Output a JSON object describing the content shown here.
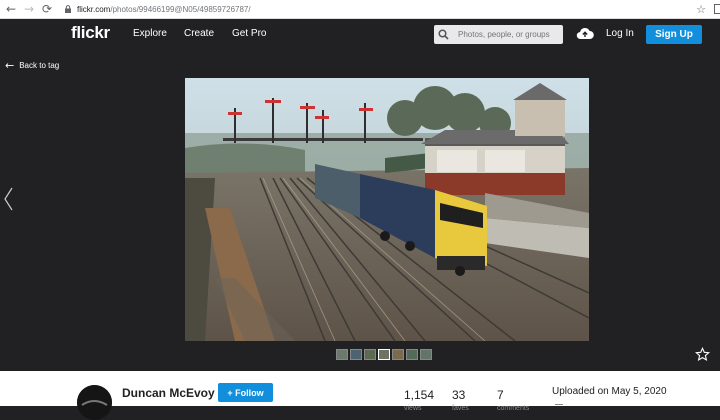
{
  "browser": {
    "url_host": "flickr.com",
    "url_path": "/photos/99466199@N05/49859726787/"
  },
  "topnav": {
    "logo": "flickr",
    "links": [
      "Explore",
      "Create",
      "Get Pro"
    ],
    "search_placeholder": "Photos, people, or groups",
    "login_label": "Log In",
    "signup_label": "Sign Up"
  },
  "viewer": {
    "back_label": "Back to tag",
    "thumbnail_count": 7
  },
  "owner": {
    "name": "Duncan McEvoy",
    "follow_label": "+ Follow"
  },
  "stats": {
    "views": "1,154",
    "views_label": "views",
    "faves": "33",
    "faves_label": "faves",
    "comments": "7",
    "comments_label": "comments"
  },
  "uploaded": "Uploaded on May 5, 2020",
  "colors": {
    "brand_blue": "#128fdc",
    "dark_bg": "#212124"
  }
}
